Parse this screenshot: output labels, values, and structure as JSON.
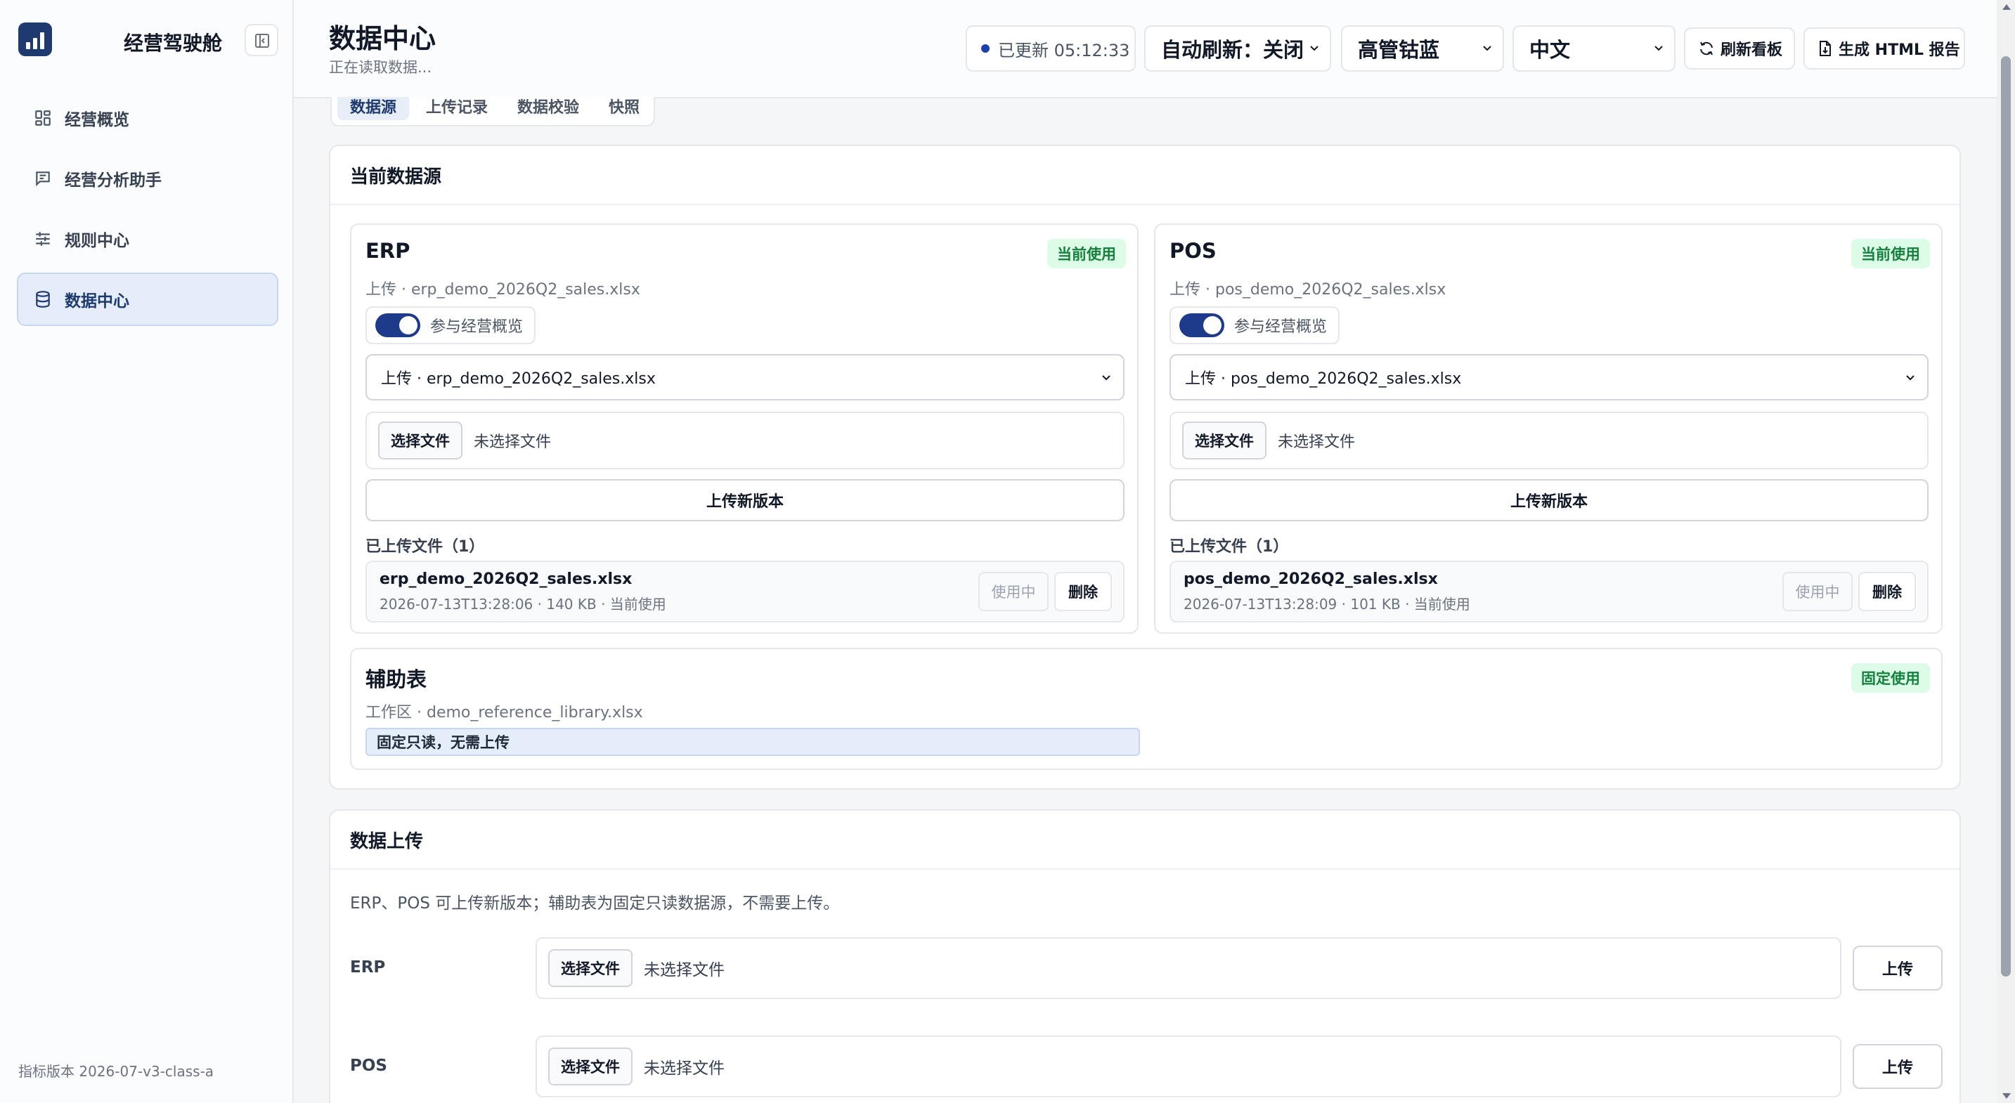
{
  "sidebar": {
    "brand": "经营驾驶舱",
    "items": [
      {
        "label": "经营概览",
        "icon": "dashboard-icon"
      },
      {
        "label": "经营分析助手",
        "icon": "chat-icon"
      },
      {
        "label": "规则中心",
        "icon": "sliders-icon"
      },
      {
        "label": "数据中心",
        "icon": "database-icon",
        "active": true
      }
    ],
    "footer": "指标版本 2026-07-v3-class-a"
  },
  "topbar": {
    "title": "数据中心",
    "subtitle": "正在读取数据...",
    "status": "已更新 05:12:33",
    "auto_refresh": "自动刷新：关闭",
    "theme": "高管钴蓝",
    "language": "中文",
    "refresh_button": "刷新看板",
    "report_button": "生成 HTML 报告"
  },
  "tabs": [
    "数据源",
    "上传记录",
    "数据校验",
    "快照"
  ],
  "current_source": {
    "title": "当前数据源",
    "sources": [
      {
        "name": "ERP",
        "badge": "当前使用",
        "file_label": "上传 · erp_demo_2026Q2_sales.xlsx",
        "toggle_label": "参与经营概览",
        "select_value": "上传 · erp_demo_2026Q2_sales.xlsx",
        "choose_file": "选择文件",
        "no_file": "未选择文件",
        "upload_new": "上传新版本",
        "uploaded_count": "已上传文件（1）",
        "uploaded_file": {
          "name": "erp_demo_2026Q2_sales.xlsx",
          "meta": "2026-07-13T13:28:06 · 140 KB · 当前使用",
          "in_use": "使用中",
          "delete": "删除"
        }
      },
      {
        "name": "POS",
        "badge": "当前使用",
        "file_label": "上传 · pos_demo_2026Q2_sales.xlsx",
        "toggle_label": "参与经营概览",
        "select_value": "上传 · pos_demo_2026Q2_sales.xlsx",
        "choose_file": "选择文件",
        "no_file": "未选择文件",
        "upload_new": "上传新版本",
        "uploaded_count": "已上传文件（1）",
        "uploaded_file": {
          "name": "pos_demo_2026Q2_sales.xlsx",
          "meta": "2026-07-13T13:28:09 · 101 KB · 当前使用",
          "in_use": "使用中",
          "delete": "删除"
        }
      }
    ],
    "aux": {
      "name": "辅助表",
      "badge": "固定使用",
      "file_label": "工作区 · demo_reference_library.xlsx",
      "note": "固定只读，无需上传"
    }
  },
  "upload": {
    "title": "数据上传",
    "note": "ERP、POS 可上传新版本；辅助表为固定只读数据源，不需要上传。",
    "rows": [
      {
        "label": "ERP",
        "choose_file": "选择文件",
        "no_file": "未选择文件",
        "button": "上传"
      },
      {
        "label": "POS",
        "choose_file": "选择文件",
        "no_file": "未选择文件",
        "button": "上传"
      }
    ]
  }
}
